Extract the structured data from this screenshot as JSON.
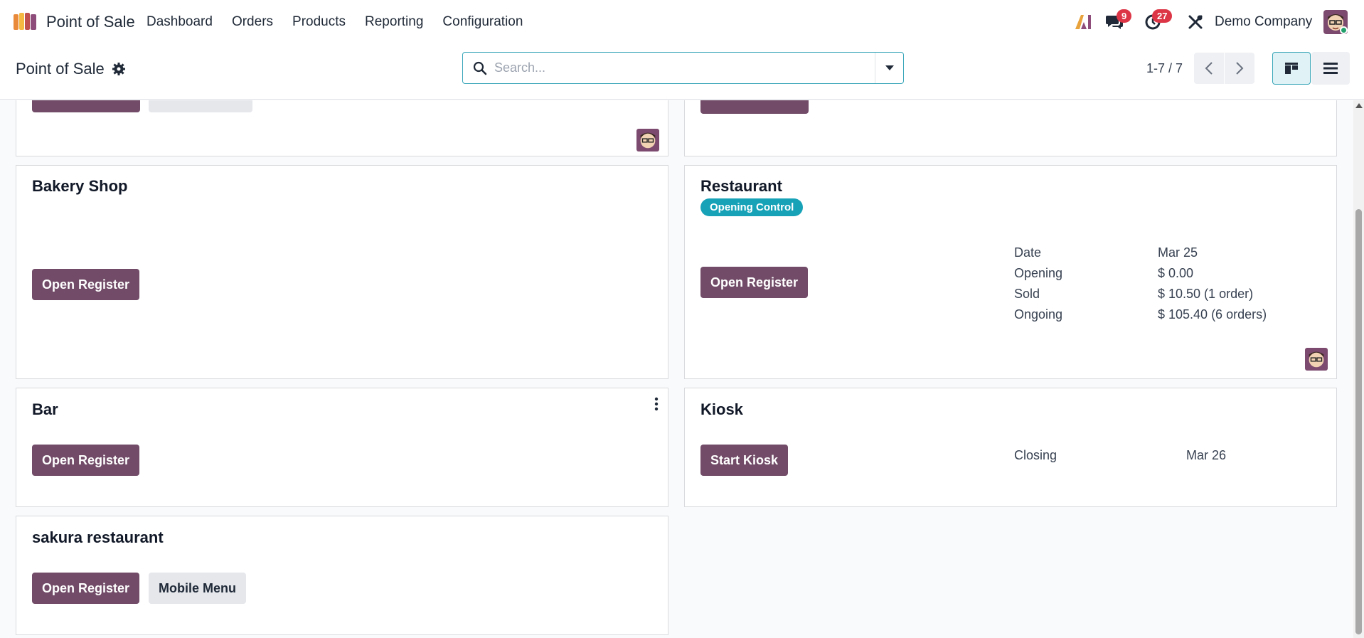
{
  "navbar": {
    "app_name": "Point of Sale",
    "menu": [
      "Dashboard",
      "Orders",
      "Products",
      "Reporting",
      "Configuration"
    ],
    "messages_count": "9",
    "activities_count": "27",
    "company": "Demo Company"
  },
  "control": {
    "title": "Point of Sale",
    "search_placeholder": "Search...",
    "pager": "1-7 / 7"
  },
  "cards": {
    "bakery": {
      "title": "Bakery Shop",
      "button": "Open Register"
    },
    "restaurant": {
      "title": "Restaurant",
      "tag": "Opening Control",
      "button": "Open Register",
      "info": [
        {
          "label": "Date",
          "value": "Mar 25"
        },
        {
          "label": "Opening",
          "value": "$ 0.00"
        },
        {
          "label": "Sold",
          "value": "$ 10.50 (1 order)"
        },
        {
          "label": "Ongoing",
          "value": "$ 105.40 (6 orders)"
        }
      ]
    },
    "bar": {
      "title": "Bar",
      "button": "Open Register"
    },
    "kiosk": {
      "title": "Kiosk",
      "button": "Start Kiosk",
      "info_label": "Closing",
      "info_value": "Mar 26"
    },
    "sakura": {
      "title": "sakura restaurant",
      "button": "Open Register",
      "button2": "Mobile Menu"
    }
  },
  "colors": {
    "primary": "#714b67",
    "tag": "#17a2b8",
    "badge": "#dc3545"
  }
}
